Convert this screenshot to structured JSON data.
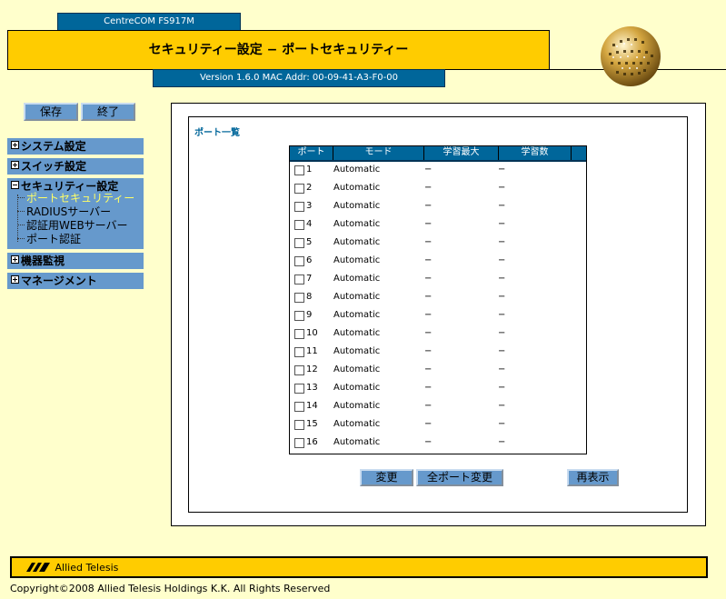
{
  "header": {
    "model": "CentreCOM FS917M",
    "title": "セキュリティー設定 − ポートセキュリティー",
    "version": "Version 1.6.0 MAC Addr: 00-09-41-A3-F0-00"
  },
  "top_buttons": {
    "save": "保存",
    "exit": "終了"
  },
  "sidebar": {
    "system": "システム設定",
    "switch": "スイッチ設定",
    "security": {
      "title": "セキュリティー設定",
      "items": [
        "ポートセキュリティー",
        "RADIUSサーバー",
        "認証用WEBサーバー",
        "ポート認証"
      ]
    },
    "monitor": "機器監視",
    "management": "マネージメント"
  },
  "main": {
    "section_title": "ポート一覧",
    "columns": [
      "ポート",
      "モード",
      "学習最大",
      "学習数"
    ],
    "rows": [
      {
        "port": "1",
        "mode": "Automatic",
        "max": "−",
        "count": "−"
      },
      {
        "port": "2",
        "mode": "Automatic",
        "max": "−",
        "count": "−"
      },
      {
        "port": "3",
        "mode": "Automatic",
        "max": "−",
        "count": "−"
      },
      {
        "port": "4",
        "mode": "Automatic",
        "max": "−",
        "count": "−"
      },
      {
        "port": "5",
        "mode": "Automatic",
        "max": "−",
        "count": "−"
      },
      {
        "port": "6",
        "mode": "Automatic",
        "max": "−",
        "count": "−"
      },
      {
        "port": "7",
        "mode": "Automatic",
        "max": "−",
        "count": "−"
      },
      {
        "port": "8",
        "mode": "Automatic",
        "max": "−",
        "count": "−"
      },
      {
        "port": "9",
        "mode": "Automatic",
        "max": "−",
        "count": "−"
      },
      {
        "port": "10",
        "mode": "Automatic",
        "max": "−",
        "count": "−"
      },
      {
        "port": "11",
        "mode": "Automatic",
        "max": "−",
        "count": "−"
      },
      {
        "port": "12",
        "mode": "Automatic",
        "max": "−",
        "count": "−"
      },
      {
        "port": "13",
        "mode": "Automatic",
        "max": "−",
        "count": "−"
      },
      {
        "port": "14",
        "mode": "Automatic",
        "max": "−",
        "count": "−"
      },
      {
        "port": "15",
        "mode": "Automatic",
        "max": "−",
        "count": "−"
      },
      {
        "port": "16",
        "mode": "Automatic",
        "max": "−",
        "count": "−"
      }
    ],
    "buttons": {
      "change": "変更",
      "all_change": "全ポート変更",
      "refresh": "再表示"
    }
  },
  "footer": {
    "brand": "Allied Telesis",
    "copyright": "Copyright©2008 Allied Telesis Holdings K.K. All Rights Reserved"
  },
  "colors": {
    "primary": "#00669A",
    "accent": "#FFCC00",
    "menu": "#6699CC",
    "background": "#FFFFCC"
  }
}
